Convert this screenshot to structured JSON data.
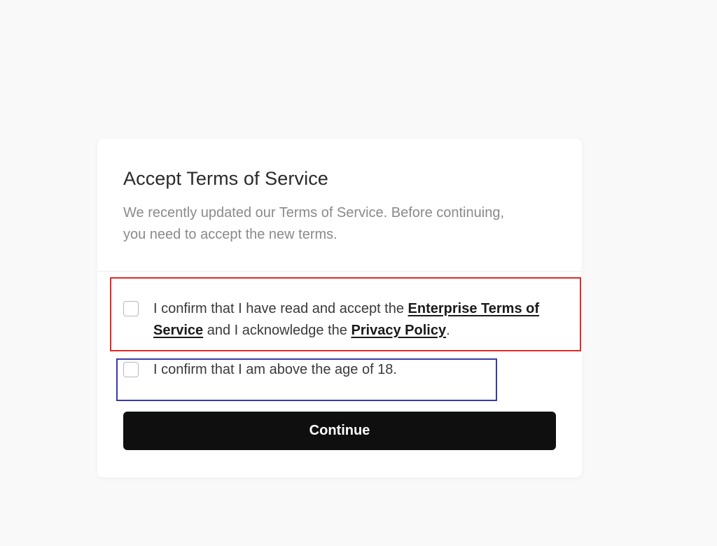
{
  "dialog": {
    "title": "Accept Terms of Service",
    "description": "We recently updated our Terms of Service. Before continuing, you need to accept the new terms.",
    "terms_consent": {
      "checked": false,
      "text_before": "I confirm that I have read and accept the ",
      "terms_link": "Enterprise Terms of Service",
      "text_middle": " and I acknowledge the ",
      "privacy_link": "Privacy Policy",
      "text_after": "."
    },
    "age_consent": {
      "checked": false,
      "text": "I confirm that I am above the age of 18."
    },
    "continue_label": "Continue"
  },
  "colors": {
    "page_background": "#f9f9f9",
    "card_background": "#ffffff",
    "button_background": "#0f0f0f",
    "button_text": "#ffffff",
    "highlight_red": "#e02a2a",
    "highlight_blue": "#3a3aa8"
  }
}
